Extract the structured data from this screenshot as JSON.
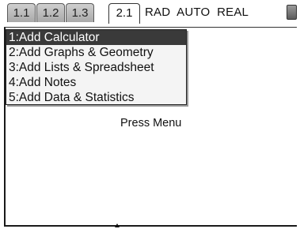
{
  "tabs": [
    {
      "label": "1.1"
    },
    {
      "label": "1.2"
    },
    {
      "label": "1.3"
    },
    {
      "label": "2.1"
    }
  ],
  "status": {
    "text": "RAD  AUTO  REAL"
  },
  "menu": {
    "items": [
      {
        "label": "1:Add Calculator"
      },
      {
        "label": "2:Add Graphs & Geometry"
      },
      {
        "label": "3:Add Lists & Spreadsheet"
      },
      {
        "label": "4:Add Notes"
      },
      {
        "label": "5:Add Data & Statistics"
      }
    ]
  },
  "hint": {
    "text": "Press Menu"
  }
}
